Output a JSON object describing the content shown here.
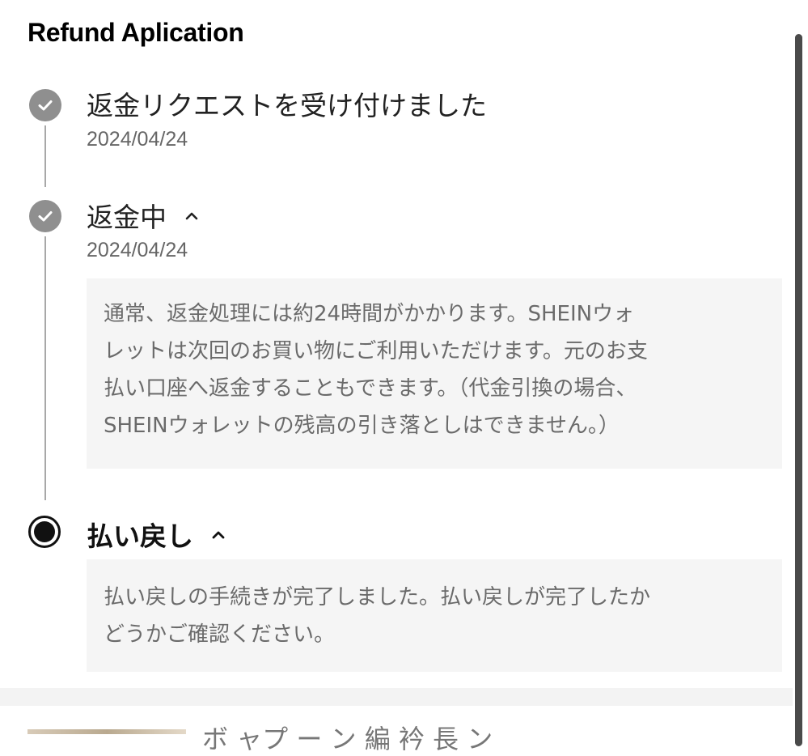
{
  "page": {
    "title": "Refund Aplication"
  },
  "steps": [
    {
      "title": "返金リクエストを受け付けました",
      "date": "2024/04/24",
      "status": "done",
      "icon": "check-circle-icon"
    },
    {
      "title": "返金中",
      "date": "2024/04/24",
      "status": "done",
      "icon": "check-circle-icon",
      "expanded": true,
      "note_lines": [
        "通常、返金処理には約24時間がかかります。SHEINウォ",
        "レットは次回のお買い物にご利用いただけます。元のお支",
        "払い口座へ返金することもできます。（代金引換の場合、",
        "SHEINウォレットの残高の引き落としはできません。）"
      ]
    },
    {
      "title": "払い戻し",
      "status": "current",
      "icon": "radio-filled-icon",
      "expanded": true,
      "note_lines": [
        "払い戻しの手続きが完了しました。払い戻しが完了したか",
        "どうかご確認ください。"
      ]
    }
  ],
  "product": {
    "partial_text": "ボ ャプ ー ン 編 衿 長 ン"
  },
  "colors": {
    "done_icon": "#8f8f8f",
    "current_icon": "#111111",
    "timeline_line": "#a8a8a8",
    "note_bg": "#f5f5f5"
  }
}
